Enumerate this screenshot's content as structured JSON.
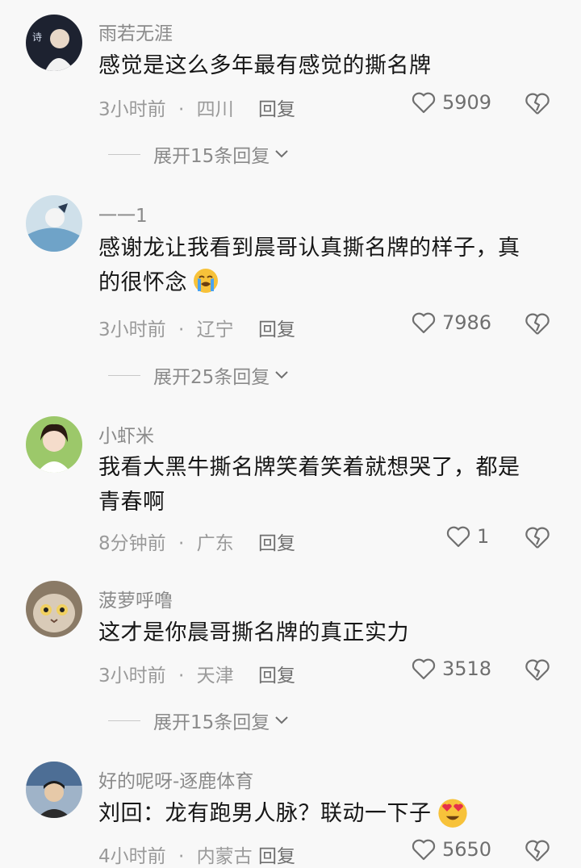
{
  "comments": [
    {
      "username": "雨若无涯",
      "text": "感觉是这么多年最有感觉的撕名牌",
      "time": "3小时前",
      "location": "四川",
      "reply_label": "回复",
      "likes": "5909",
      "expand_label": "展开15条回复"
    },
    {
      "username": "一一1",
      "text_line1": "感谢龙让我看到晨哥认真撕名牌的样子，真",
      "text_line2": "的很怀念",
      "time": "3小时前",
      "location": "辽宁",
      "reply_label": "回复",
      "likes": "7986",
      "expand_label": "展开25条回复"
    },
    {
      "username": "小虾米",
      "text_line1": "我看大黑牛撕名牌笑着笑着就想哭了，都是",
      "text_line2": "青春啊",
      "time": "8分钟前",
      "location": "广东",
      "reply_label": "回复",
      "likes": "1"
    },
    {
      "username": "菠萝呼噜",
      "text": "这才是你晨哥撕名牌的真正实力",
      "time": "3小时前",
      "location": "天津",
      "reply_label": "回复",
      "likes": "3518",
      "expand_label": "展开15条回复"
    },
    {
      "username": "好的呢呀-逐鹿体育",
      "text": "刘回：龙有跑男人脉？联动一下子",
      "time": "4小时前",
      "location": "内蒙古",
      "reply_label": "回复",
      "likes": "5650"
    }
  ],
  "meta_separator": "·",
  "colors": {
    "background": "#f8f8f8",
    "username": "#8a8a8a",
    "meta": "#9a9a9a"
  }
}
